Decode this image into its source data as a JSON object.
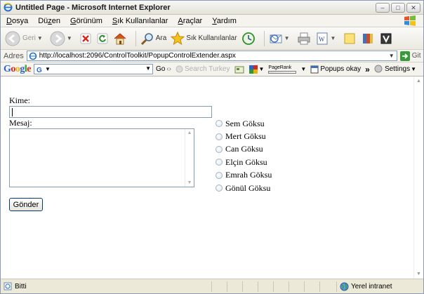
{
  "window": {
    "title": "Untitled Page - Microsoft Internet Explorer"
  },
  "menu": {
    "items": [
      {
        "label": "Dosya",
        "key": "D"
      },
      {
        "label": "Düzen",
        "key": "z"
      },
      {
        "label": "Görünüm",
        "key": "G"
      },
      {
        "label": "Sık Kullanılanlar",
        "key": "S"
      },
      {
        "label": "Araçlar",
        "key": "A"
      },
      {
        "label": "Yardım",
        "key": "Y"
      }
    ]
  },
  "toolbar": {
    "back_label": "Geri",
    "search_label": "Ara",
    "favorites_label": "Sık Kullanılanlar"
  },
  "address": {
    "label": "Adres",
    "url": "http://localhost:2096/ControlToolkit/PopupControlExtender.aspx",
    "go_label": "Git"
  },
  "google_toolbar": {
    "logo": "Google",
    "go_label": "Go",
    "search_country": "Search Turkey",
    "pagerank_label": "PageRank",
    "popups_label": "Popups okay",
    "more": "»",
    "settings_label": "Settings"
  },
  "form": {
    "to_label": "Kime:",
    "message_label": "Mesaj:",
    "send_label": "Gönder",
    "recipients": [
      "Sem Göksu",
      "Mert Göksu",
      "Can Göksu",
      "Elçin Göksu",
      "Emrah Göksu",
      "Gönül Göksu"
    ]
  },
  "status": {
    "text": "Bitti",
    "zone": "Yerel intranet"
  },
  "colors": {
    "accent": "#0a246a",
    "border": "#7f9db9",
    "go_green": "#3a9a3a"
  }
}
